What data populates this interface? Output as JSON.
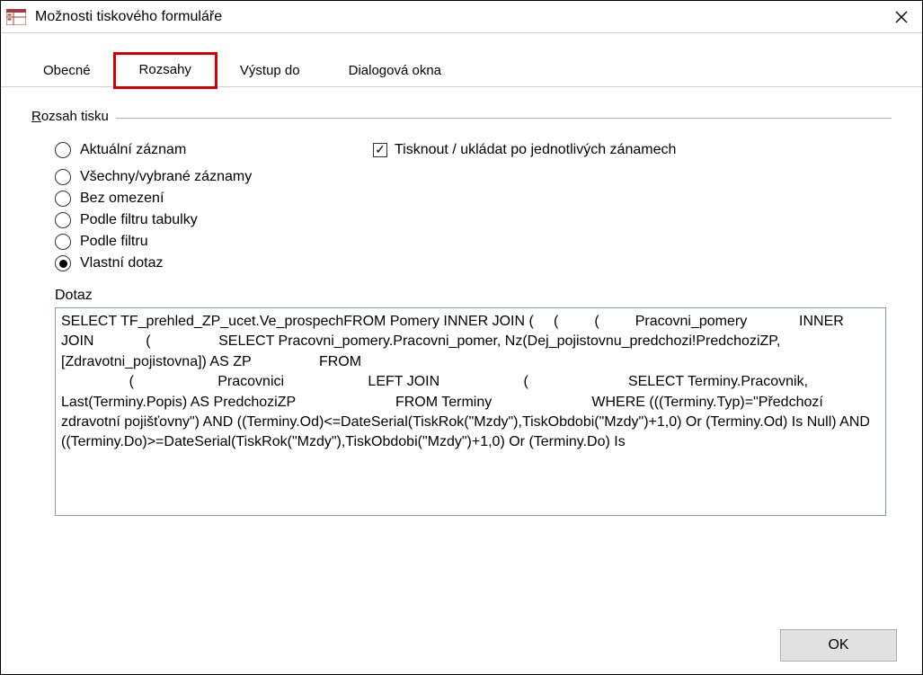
{
  "window": {
    "title": "Možnosti tiskového formuláře"
  },
  "tabs": [
    {
      "label": "Obecné",
      "active": false
    },
    {
      "label": "Rozsahy",
      "active": true
    },
    {
      "label": "Výstup do",
      "active": false
    },
    {
      "label": "Dialogová okna",
      "active": false
    }
  ],
  "group": {
    "label_prefix": "R",
    "label_rest": "ozsah tisku"
  },
  "radios": {
    "aktualni": "Aktuální záznam",
    "vsechny": "Všechny/vybrané záznamy",
    "bez": "Bez omezení",
    "filtr_tab": "Podle filtru tabulky",
    "filtr": "Podle filtru",
    "vlastni": "Vlastní dotaz"
  },
  "checkbox": {
    "tisknout": "Tisknout / ukládat po jednotlivých zánamech"
  },
  "dotaz_label": "Dotaz",
  "query_text": "SELECT TF_prehled_ZP_ucet.Ve_prospechFROM Pomery INNER JOIN (     (         (         Pracovni_pomery             INNER JOIN             (                 SELECT Pracovni_pomery.Pracovni_pomer, Nz(Dej_pojistovnu_predchozi!PredchoziZP,[Zdravotni_pojistovna]) AS ZP                 FROM                                                                            \n                 (                     Pracovnici                     LEFT JOIN                     (                         SELECT Terminy.Pracovnik, Last(Terminy.Popis) AS PredchoziZP                         FROM Terminy                         WHERE (((Terminy.Typ)=\"Předchozí zdravotní pojišťovny\") AND ((Terminy.Od)<=DateSerial(TiskRok(\"Mzdy\"),TiskObdobi(\"Mzdy\")+1,0) Or (Terminy.Od) Is Null) AND ((Terminy.Do)>=DateSerial(TiskRok(\"Mzdy\"),TiskObdobi(\"Mzdy\")+1,0) Or (Terminy.Do) Is",
  "footer": {
    "ok": "OK"
  }
}
